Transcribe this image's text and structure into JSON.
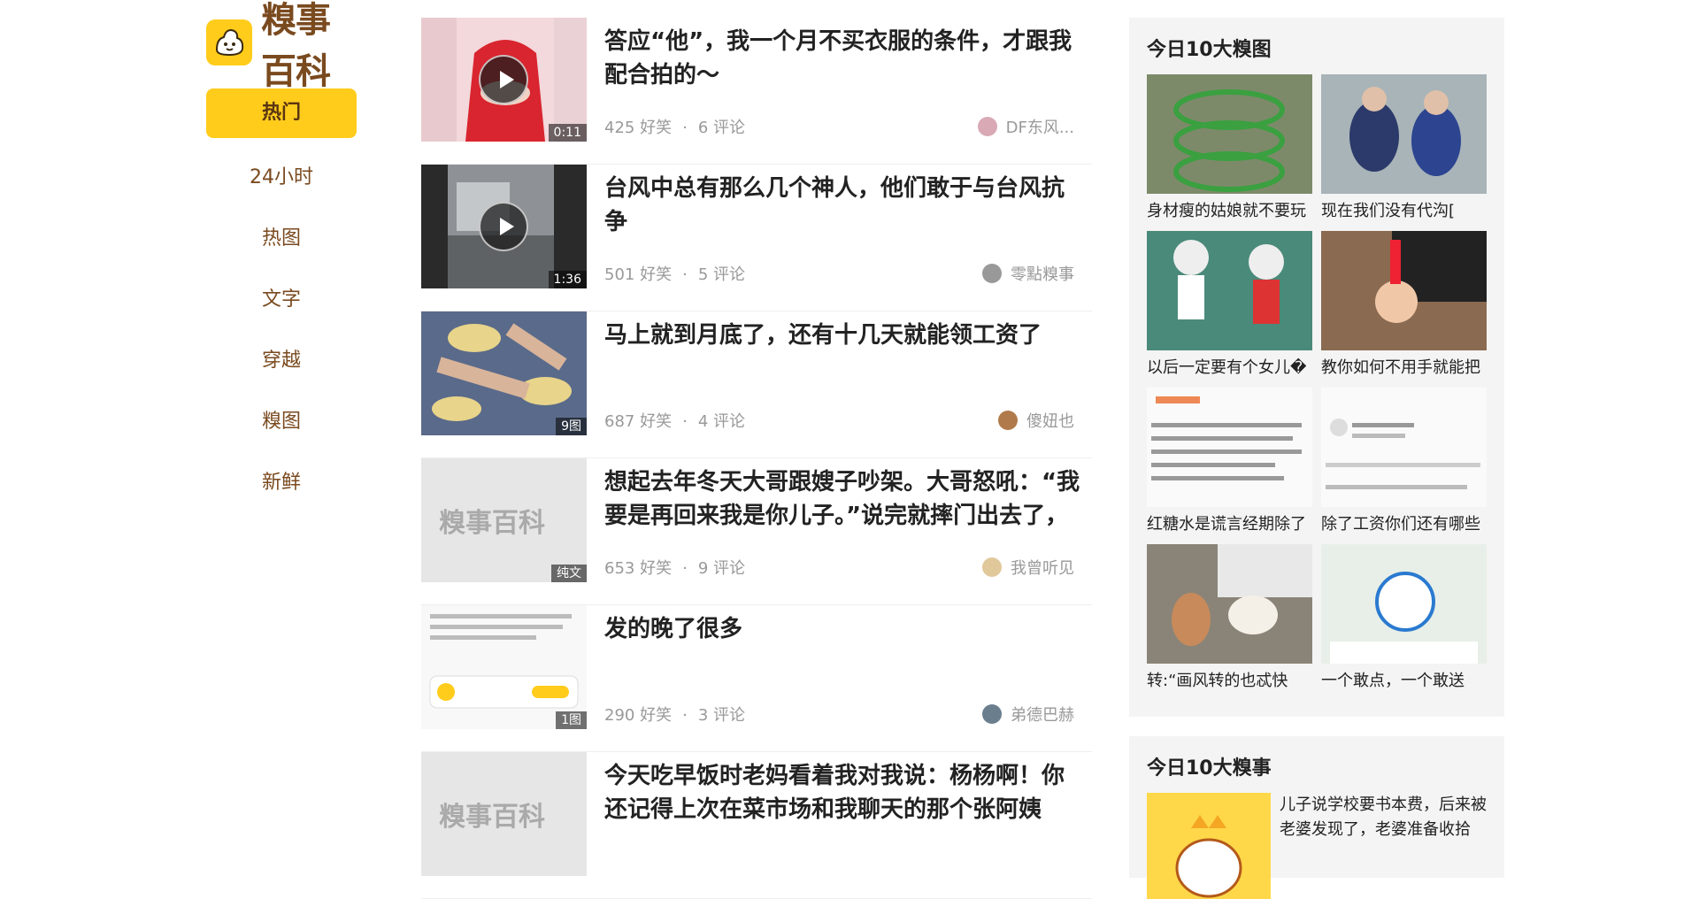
{
  "brand": {
    "logo_text": "糗事百科",
    "accent": "#ffcc1c",
    "text_brown": "#7a4a1f"
  },
  "nav": [
    {
      "label": "热门",
      "active": true
    },
    {
      "label": "24小时"
    },
    {
      "label": "热图"
    },
    {
      "label": "文字"
    },
    {
      "label": "穿越"
    },
    {
      "label": "糗图"
    },
    {
      "label": "新鲜"
    }
  ],
  "articles": [
    {
      "title": "答应“他”，我一个月不买衣服的条件，才跟我配合拍的～",
      "thumb_label": "0:11",
      "video": true,
      "likes": "425 好笑",
      "comments": "6 评论",
      "author": "DF东风..."
    },
    {
      "title": "台风中总有那么几个神人，他们敢于与台风抗争",
      "thumb_label": "1:36",
      "video": true,
      "likes": "501 好笑",
      "comments": "5 评论",
      "author": "零點糗事"
    },
    {
      "title": "马上就到月底了，还有十几天就能领工资了",
      "thumb_label": "9图",
      "video": false,
      "likes": "687 好笑",
      "comments": "4 评论",
      "author": "傻妞也"
    },
    {
      "title": "想起去年冬天大哥跟嫂子吵架。大哥怒吼：“我要是再回来我是你儿子。”说完就摔门出去了，天实",
      "thumb_label": "纯文",
      "video": false,
      "likes": "653 好笑",
      "comments": "9 评论",
      "author": "我曾听见"
    },
    {
      "title": "发的晚了很多",
      "thumb_label": "1图",
      "video": false,
      "likes": "290 好笑",
      "comments": "3 评论",
      "author": "弟德巴赫"
    },
    {
      "title": "今天吃早饭时老妈看着我对我说：杨杨啊！你还记得上次在菜市场和我聊天的那个张阿姨吗？",
      "thumb_label": "",
      "video": false,
      "likes": "",
      "comments": "",
      "author": ""
    }
  ],
  "thumb_placeholder_text": "糗事百科",
  "dot": "·",
  "side": {
    "pics_title": "今日10大糗图",
    "pics": [
      {
        "caption": "身材瘦的姑娘就不要玩"
      },
      {
        "caption": "现在我们没有代沟["
      },
      {
        "caption": "以后一定要有个女儿�"
      },
      {
        "caption": "教你如何不用手就能把"
      },
      {
        "caption": "红糖水是谎言经期除了"
      },
      {
        "caption": "除了工资你们还有哪些"
      },
      {
        "caption": "转:“画风转的也忒快"
      },
      {
        "caption": "一个敢点，一个敢送"
      }
    ],
    "stories_title": "今日10大糗事",
    "story_text": "儿子说学校要书本费，后来被老婆发现了，老婆准备收拾"
  }
}
